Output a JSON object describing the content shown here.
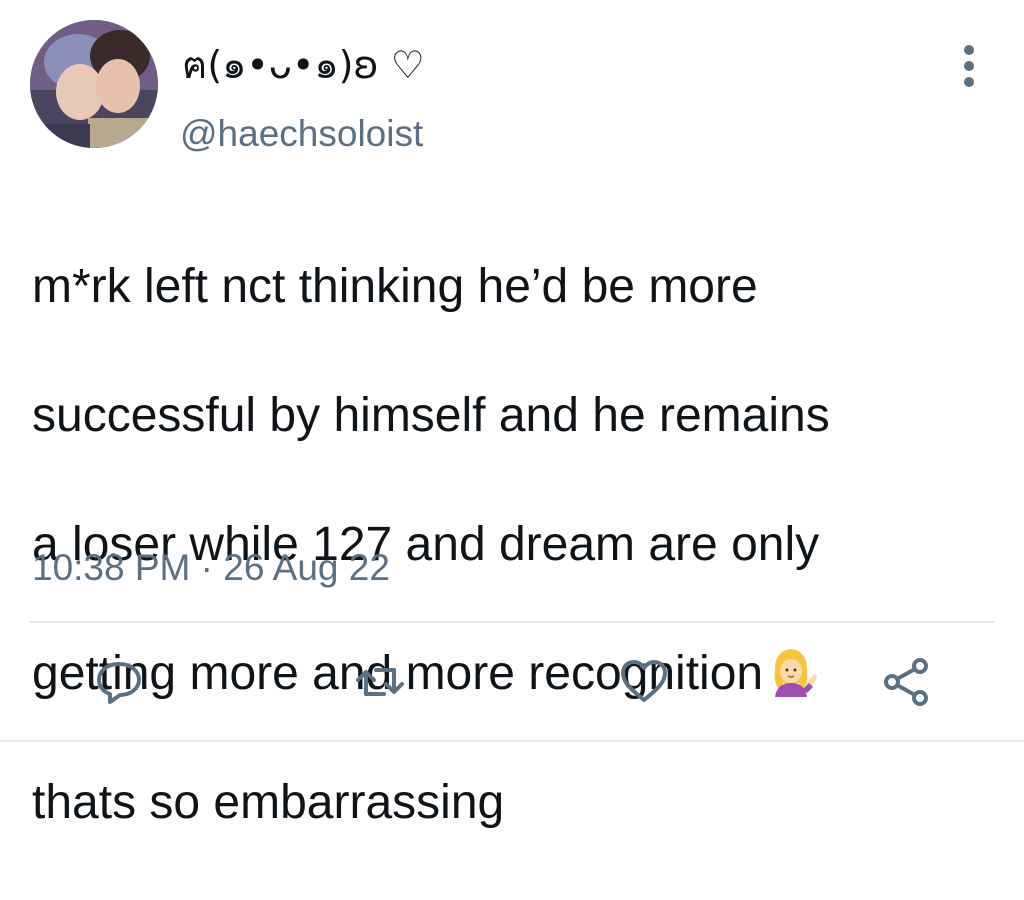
{
  "user": {
    "display_name": "ฅ(๑•ᴗ•๑)ʚ ♡",
    "handle": "@haechsoloist"
  },
  "tweet": {
    "lines": [
      "m*rk left nct thinking he’d be more",
      "successful by himself and he remains",
      "a loser while 127 and dream are only",
      "getting more and more recognition",
      "thats so embarrassing"
    ],
    "emoji": "person-tipping-hand-emoji",
    "timestamp": "10:38 PM · 26 Aug 22"
  },
  "actions": {
    "reply_icon": "reply-icon",
    "retweet_icon": "retweet-icon",
    "like_icon": "heart-icon",
    "share_icon": "share-icon"
  },
  "colors": {
    "text": "#0f1419",
    "secondary": "#5b7083",
    "divider": "#e1e8ed"
  }
}
